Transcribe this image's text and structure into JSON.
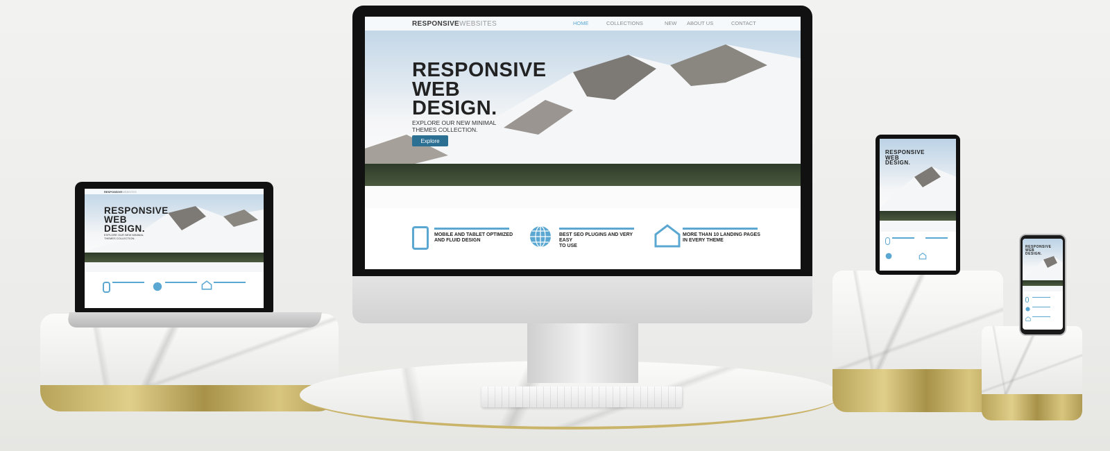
{
  "site": {
    "brand_bold": "RESPONSIVE",
    "brand_light": "WEBSITES",
    "nav": [
      "HOME",
      "COLLECTIONS",
      "NEW",
      "ABOUT US",
      "CONTACT"
    ],
    "headline_1": "RESPONSIVE",
    "headline_2": "WEB",
    "headline_3": "DESIGN.",
    "sub_1": "EXPLORE OUR NEW MINIMAL",
    "sub_2": "THEMES COLLECTION.",
    "cta": "Explore",
    "features": [
      {
        "line1": "MOBILE AND TABLET OPTIMIZED",
        "line2": "AND FLUID DESIGN",
        "icon": "tablet-icon"
      },
      {
        "line1": "BEST SEO PLUGINS AND VERY EASY",
        "line2": "TO USE",
        "icon": "globe-icon"
      },
      {
        "line1": "MORE THAN 10 LANDING PAGES",
        "line2": "IN EVERY THEME",
        "icon": "home-icon"
      }
    ]
  },
  "colors": {
    "accent": "#5aa7d1",
    "button": "#2b6f93",
    "text": "#222222",
    "gold": "#c9b46a"
  }
}
